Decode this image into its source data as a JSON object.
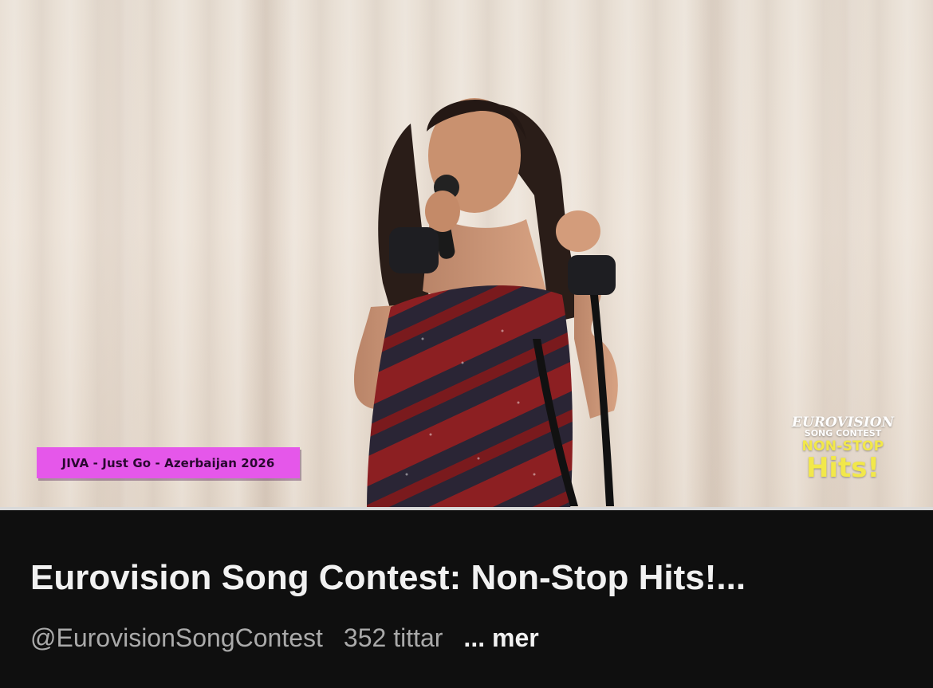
{
  "video": {
    "overlay_caption": "JIVA - Just Go - Azerbaijan 2026",
    "logo": {
      "line1": "EUROVISION",
      "line2": "SONG CONTEST",
      "line3": "NON-STOP",
      "line4": "Hits!"
    },
    "colors": {
      "caption_bg": "#e557ea",
      "logo_accent": "#f2e84a",
      "curtain": "#e9e0d5"
    }
  },
  "details": {
    "title": "Eurovision Song Contest: Non-Stop Hits!...",
    "channel_handle": "@EurovisionSongContest",
    "viewers": "352 tittar",
    "more_label": "... mer"
  }
}
